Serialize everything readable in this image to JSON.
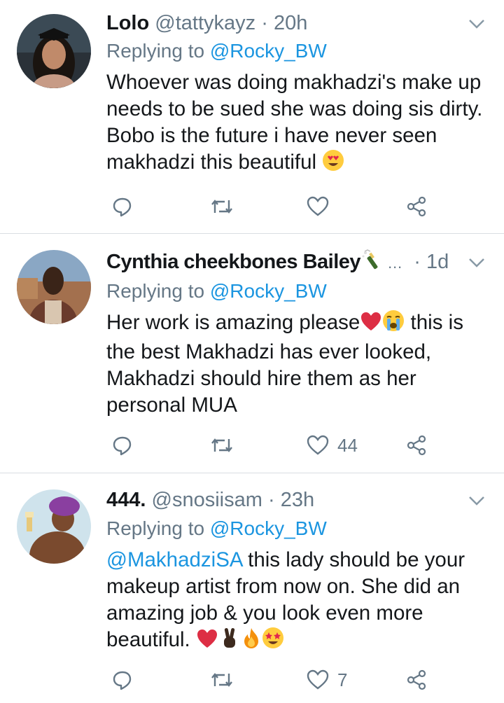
{
  "tweets": [
    {
      "name": "Lolo",
      "handle": "@tattykayz",
      "sep": "·",
      "time": "20h",
      "replying_prefix": "Replying to",
      "replying_to": "@Rocky_BW",
      "text": "Whoever was doing makhadzi's make up\nneeds to be sued she was doing sis dirty.\nBobo is the future i have never seen\nmakhadzi this beautiful",
      "emojis": [
        "heart-eyes-emoji"
      ],
      "likes": "",
      "retweets": ""
    },
    {
      "name": "Cynthia cheekbones Bailey",
      "name_suffix": "…",
      "sep": "·",
      "time": "1d",
      "replying_prefix": "Replying to",
      "replying_to": "@Rocky_BW",
      "text_line1": "Her work is amazing please",
      "text_after_emojis": " this is",
      "text_rest": "the best Makhadzi has ever looked,\nMakhadzi should hire them as her\npersonal MUA",
      "emojis": [
        "champagne-emoji",
        "red-heart-emoji",
        "crying-face-emoji"
      ],
      "likes": "44"
    },
    {
      "name": "444.",
      "handle": "@snosiisam",
      "sep": "·",
      "time": "23h",
      "replying_prefix": "Replying to",
      "replying_to": "@Rocky_BW",
      "mention": "@MakhadziSA",
      "text_line1": " this lady should be your",
      "text_rest": "makeup artist from now on. She did an\namazing job & you look even more\nbeautiful.",
      "emojis": [
        "red-heart-emoji",
        "victory-hand-emoji",
        "fire-emoji",
        "star-struck-emoji"
      ],
      "likes": "7"
    }
  ],
  "colors": {
    "text": "#14171a",
    "muted": "#657786",
    "link": "#1b95e0",
    "divider": "#d9dee2"
  }
}
